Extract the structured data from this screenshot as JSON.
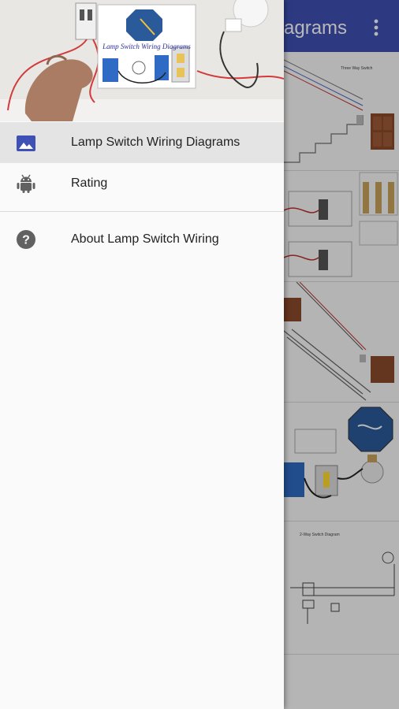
{
  "app_bar": {
    "title_visible": "agrams",
    "overflow_icon": "more-vert-icon",
    "color": "#3f51b5"
  },
  "drawer": {
    "header_image": "Lamp Switch Wiring Diagrams",
    "menu": [
      {
        "label": "Lamp Switch Wiring Diagrams",
        "icon": "image-icon",
        "selected": true
      },
      {
        "label": "Rating",
        "icon": "android-icon",
        "selected": false
      },
      {
        "label": "About Lamp Switch Wiring",
        "icon": "help-icon",
        "selected": false
      }
    ]
  },
  "colors": {
    "accent": "#3f51b5",
    "selected_bg": "#e4e4e4",
    "icon_grey": "#616161"
  }
}
